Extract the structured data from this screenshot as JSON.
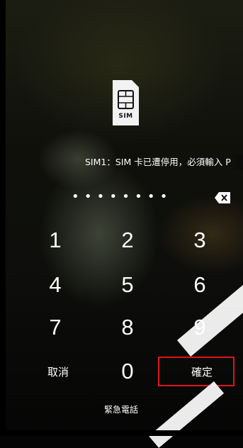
{
  "sim_card": {
    "icon": "sim-card-icon",
    "label": "SIM"
  },
  "status": {
    "message": "SIM1：SIM 卡已遭停用，必須輸入 P"
  },
  "pin": {
    "masked_value": "••••••••",
    "backspace_icon": "backspace-icon"
  },
  "keypad": {
    "keys": [
      "1",
      "2",
      "3",
      "4",
      "5",
      "6",
      "7",
      "8",
      "9",
      "0"
    ],
    "cancel_label": "取消",
    "confirm_label": "確定"
  },
  "emergency_call_label": "緊急電話",
  "colors": {
    "highlight": "#e0121b",
    "text": "#ffffff"
  }
}
